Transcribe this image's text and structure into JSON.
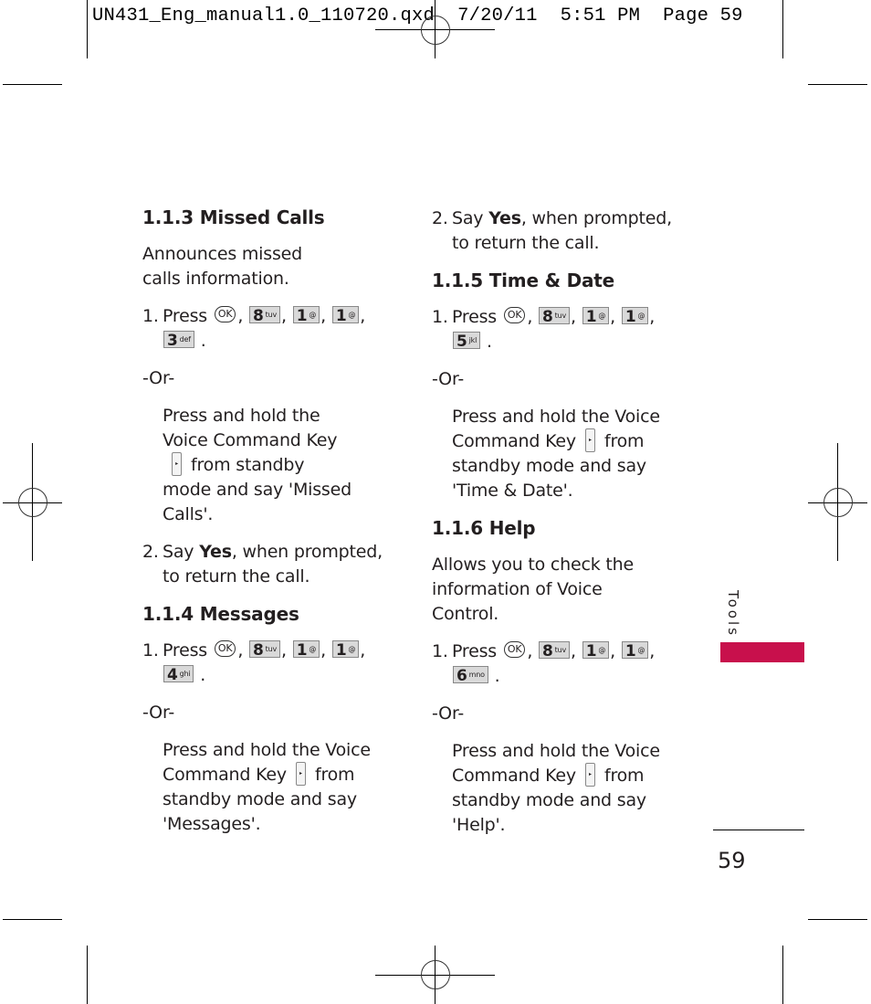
{
  "slug_line": "UN431_Eng_manual1.0_110720.qxd  7/20/11  5:51 PM  Page 59",
  "colors": {
    "accent": "#c8104c",
    "text": "#231f20",
    "key_fill": "#d9d9d9"
  },
  "icons": {
    "ok_key": "ok-key-icon",
    "voice_command_key": "voice-command-key-icon",
    "number_key": "keypad-key-icon"
  },
  "keys": {
    "ok": "OK",
    "k8": {
      "digit": "8",
      "letters": "tuv"
    },
    "k1": {
      "digit": "1",
      "letters": "@"
    },
    "k3": {
      "digit": "3",
      "letters": "def"
    },
    "k4": {
      "digit": "4",
      "letters": "ghi"
    },
    "k5": {
      "digit": "5",
      "letters": "jkl"
    },
    "k6": {
      "digit": "6",
      "letters": "mno"
    }
  },
  "left": {
    "missed": {
      "title": "1.1.3 Missed Calls",
      "desc": "Announces missed calls information.",
      "step1_num": "1.",
      "step1_text": "Press",
      "or": "-Or-",
      "alt_a": "Press and hold the Voice Command Key",
      "alt_b": "from standby mode and say 'Missed Calls'.",
      "step2_num": "2.",
      "step2_a": "Say",
      "step2_bold": "Yes",
      "step2_b": ", when prompted, to return the call."
    },
    "messages": {
      "title": "1.1.4 Messages",
      "step1_num": "1.",
      "step1_text": "Press",
      "or": "-Or-",
      "alt_a": "Press and hold the Voice Command Key",
      "alt_b": "from standby mode and say 'Messages'."
    }
  },
  "right": {
    "cont": {
      "step2_num": "2.",
      "step2_a": "Say",
      "step2_bold": "Yes",
      "step2_b": ", when prompted, to return the call."
    },
    "timedate": {
      "title": "1.1.5 Time & Date",
      "step1_num": "1.",
      "step1_text": "Press",
      "or": "-Or-",
      "alt_a": "Press and hold the Voice Command Key",
      "alt_b": "from standby mode and say 'Time & Date'."
    },
    "help": {
      "title": "1.1.6 Help",
      "desc": "Allows you to check the information of Voice Control.",
      "step1_num": "1.",
      "step1_text": "Press",
      "or": "-Or-",
      "alt_a": "Press and hold the Voice Command Key",
      "alt_b": "from standby mode and say 'Help'."
    }
  },
  "side_tab": "Tools",
  "page_number": "59"
}
